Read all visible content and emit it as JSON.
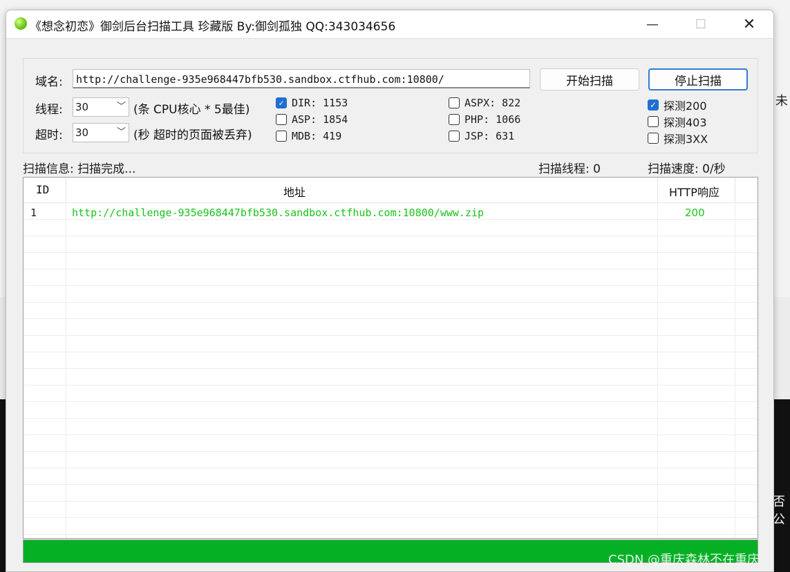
{
  "window": {
    "title": "《想念初恋》御剑后台扫描工具 珍藏版 By:御剑孤独 QQ:343034656",
    "minimize": "—",
    "maximize": "☐",
    "close": "✕"
  },
  "form": {
    "domain_label": "域名:",
    "domain_value": "http://challenge-935e968447bfb530.sandbox.ctfhub.com:10800/",
    "threads_label": "线程:",
    "threads_value": "30",
    "threads_hint": "(条 CPU核心 * 5最佳)",
    "timeout_label": "超时:",
    "timeout_value": "30",
    "timeout_hint": "(秒 超时的页面被丢弃)",
    "start_button": "开始扫描",
    "stop_button": "停止扫描"
  },
  "dicts": [
    {
      "label": "DIR: 1153",
      "checked": true
    },
    {
      "label": "ASP: 1854",
      "checked": false
    },
    {
      "label": "MDB: 419",
      "checked": false
    },
    {
      "label": "ASPX: 822",
      "checked": false
    },
    {
      "label": "PHP: 1066",
      "checked": false
    },
    {
      "label": "JSP: 631",
      "checked": false
    }
  ],
  "probes": [
    {
      "label": "探测200",
      "checked": true
    },
    {
      "label": "探测403",
      "checked": false
    },
    {
      "label": "探测3XX",
      "checked": false
    }
  ],
  "status": {
    "info": "扫描信息: 扫描完成...",
    "threads": "扫描线程: 0",
    "speed": "扫描速度: 0/秒"
  },
  "table": {
    "headers": [
      "ID",
      "地址",
      "HTTP响应"
    ],
    "rows": [
      {
        "id": "1",
        "url": "http://challenge-935e968447bfb530.sandbox.ctfhub.com:10800/www.zip",
        "code": "200"
      }
    ]
  },
  "progress": {
    "fraction": 1.0
  },
  "watermark": "CSDN @重庆森林不在重庆",
  "background": {
    "right_text_1": "未",
    "right_text_2": "否公"
  },
  "colors": {
    "progress": "#06b025",
    "found": "#19c319",
    "accent": "#1f6fd1"
  }
}
